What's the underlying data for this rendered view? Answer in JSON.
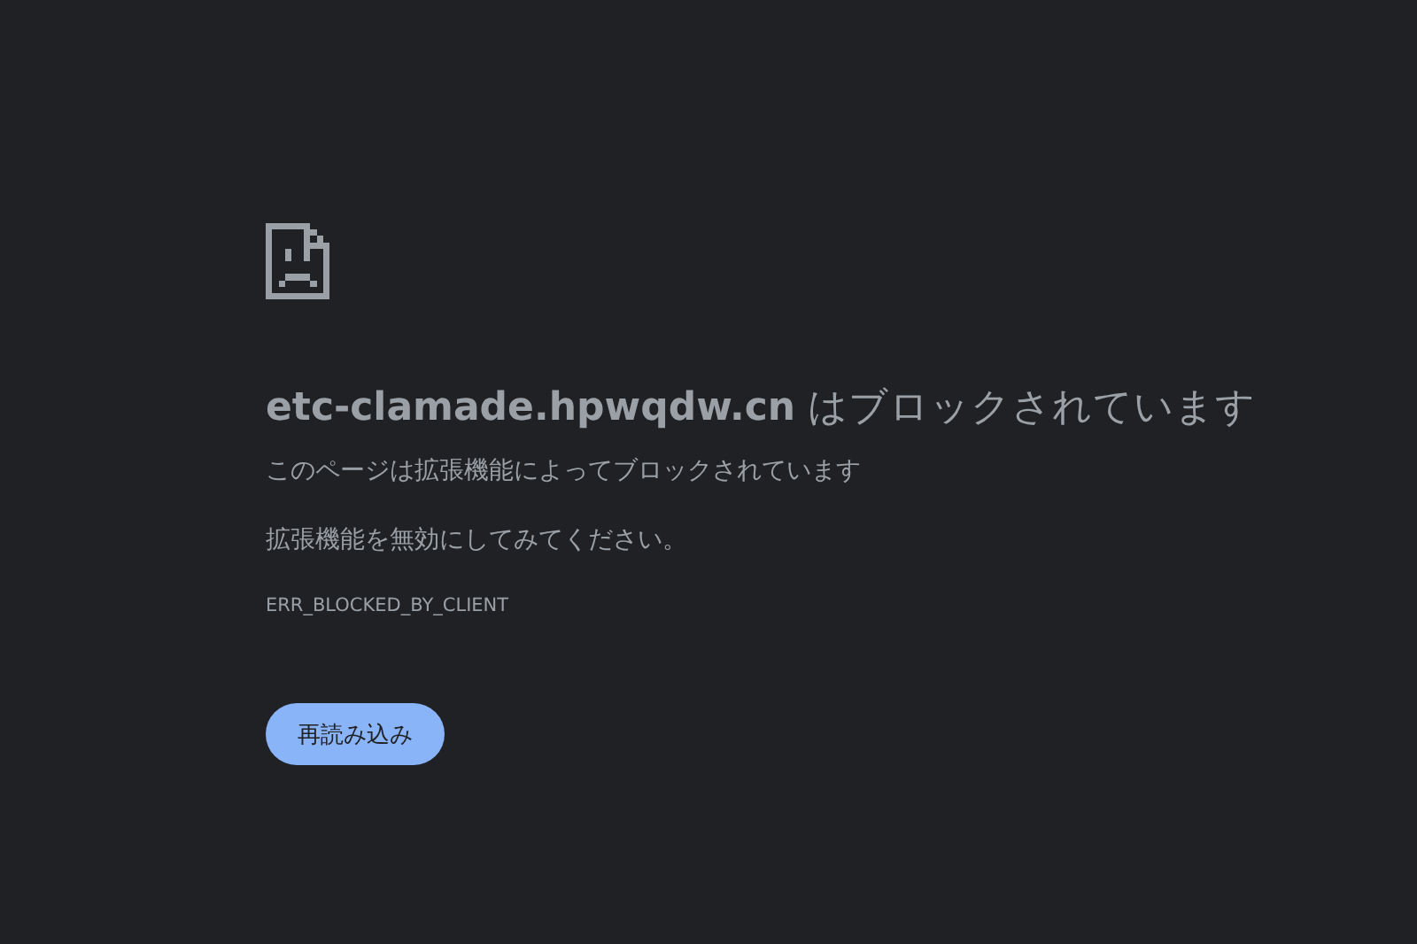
{
  "heading": "**etc-clamade.hpwqdw.cn** はブロックされています",
  "message": "このページは拡張機能によってブロックされています",
  "suggestion": "拡張機能を無効にしてみてください。",
  "error_code": "ERR_BLOCKED_BY_CLIENT",
  "reload_button": "再読み込み"
}
